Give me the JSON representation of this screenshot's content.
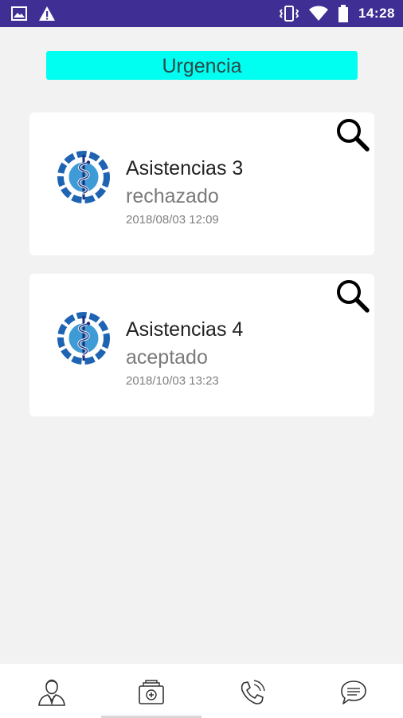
{
  "status_bar": {
    "time": "14:28",
    "icons_left": [
      "image-icon",
      "warning-icon"
    ],
    "icons_right": [
      "vibrate-icon",
      "wifi-icon",
      "battery-icon"
    ],
    "background": "#3f2f94"
  },
  "header": {
    "label": "Urgencia",
    "background": "#00fff0"
  },
  "cards": [
    {
      "title": "Asistencias 3",
      "status": "rechazado",
      "date": "2018/08/03 12:09",
      "icon": "medical-caduceus-icon",
      "action_icon": "search-icon"
    },
    {
      "title": "Asistencias 4",
      "status": "aceptado",
      "date": "2018/10/03 13:23",
      "icon": "medical-caduceus-icon",
      "action_icon": "search-icon"
    }
  ],
  "bottom_nav": {
    "items": [
      {
        "icon": "doctor-profile-icon"
      },
      {
        "icon": "medical-kit-icon",
        "selected": true
      },
      {
        "icon": "phone-call-icon"
      },
      {
        "icon": "chat-bubble-icon"
      }
    ]
  }
}
